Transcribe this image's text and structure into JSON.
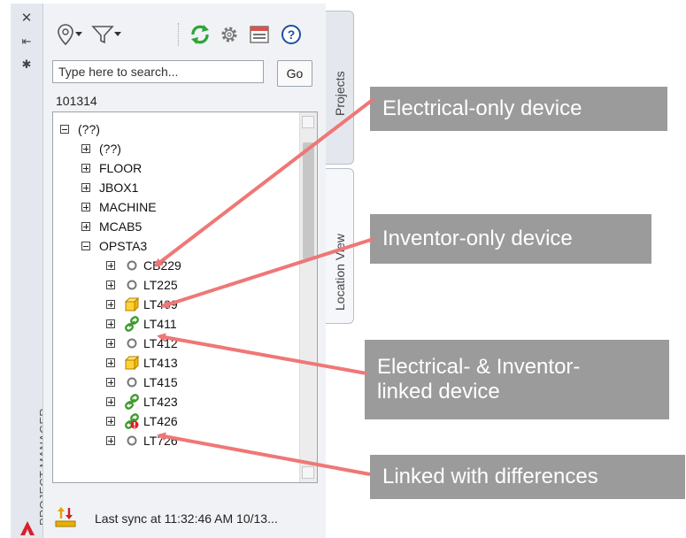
{
  "side_strip": {
    "title": "PROJECT MANAGER",
    "icons": [
      "close-icon",
      "pin-icon",
      "settings-icon"
    ]
  },
  "toolbar": {
    "icons": [
      "location-pin-icon",
      "filter-icon",
      "refresh-icon",
      "gear-icon",
      "display-config-icon",
      "help-icon"
    ]
  },
  "search": {
    "placeholder": "Type here to search...",
    "go_label": "Go"
  },
  "project_number": "101314",
  "tree": {
    "root": "(??)",
    "locations": [
      "(??)",
      "FLOOR",
      "JBOX1",
      "MACHINE",
      "MCAB5",
      "OPSTA3"
    ],
    "devices": [
      {
        "label": "CB229",
        "icon": "electrical-only-icon"
      },
      {
        "label": "LT225",
        "icon": "electrical-only-icon"
      },
      {
        "label": "LT409",
        "icon": "inventor-only-icon"
      },
      {
        "label": "LT411",
        "icon": "linked-icon"
      },
      {
        "label": "LT412",
        "icon": "electrical-only-icon"
      },
      {
        "label": "LT413",
        "icon": "inventor-only-icon"
      },
      {
        "label": "LT415",
        "icon": "electrical-only-icon"
      },
      {
        "label": "LT423",
        "icon": "linked-icon"
      },
      {
        "label": "LT426",
        "icon": "linked-differences-icon"
      },
      {
        "label": "LT726",
        "icon": "electrical-only-icon"
      }
    ]
  },
  "status": {
    "text": "Last sync at 11:32:46 AM 10/13..."
  },
  "tabs": {
    "projects": "Projects",
    "location_view": "Location View"
  },
  "callouts": {
    "electrical_only": "Electrical-only device",
    "inventor_only": "Inventor-only device",
    "linked_line1": "Electrical- & Inventor-",
    "linked_line2": "linked device",
    "differences": "Linked with differences"
  },
  "colors": {
    "callout_bg": "#9b9b9b",
    "arrow": "#ef7777",
    "panel_bg": "#f0f2f5"
  }
}
